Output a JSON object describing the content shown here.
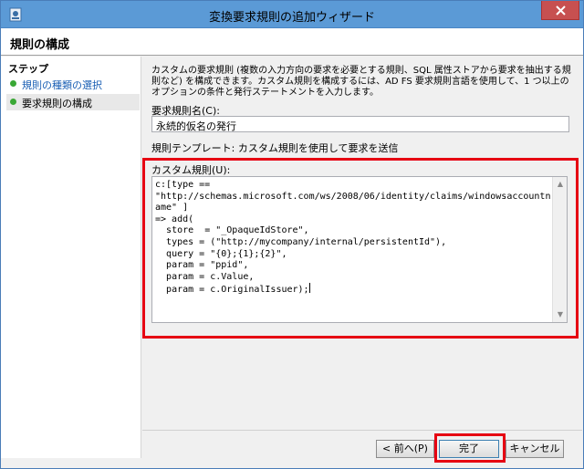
{
  "window": {
    "title": "変換要求規則の追加ウィザード",
    "close_glyph": "✕"
  },
  "header": {
    "title": "規則の構成"
  },
  "steps": {
    "title": "ステップ",
    "items": [
      {
        "label": "規則の種類の選択"
      },
      {
        "label": "要求規則の構成"
      }
    ]
  },
  "main": {
    "description": "カスタムの要求規則 (複数の入力方向の要求を必要とする規則、SQL 属性ストアから要求を抽出する規則など) を構成できます。カスタム規則を構成するには、AD FS 要求規則言語を使用して、1 つ以上のオプションの条件と発行ステートメントを入力します。",
    "rule_name_label": "要求規則名(C):",
    "rule_name_value": "永続的仮名の発行",
    "template_text": "規則テンプレート: カスタム規則を使用して要求を送信",
    "custom_rule_label": "カスタム規則(U):",
    "custom_rule_value": "c:[type ==\n\"http://schemas.microsoft.com/ws/2008/06/identity/claims/windowsaccountname\" ]\n=> add(\n  store  = \"_OpaqueIdStore\",\n  types = (\"http://mycompany/internal/persistentId\"),\n  query = \"{0};{1};{2}\",\n  param = \"ppid\",\n  param = c.Value,\n  param = c.OriginalIssuer);"
  },
  "footer": {
    "back_label": "< 前へ(P)",
    "finish_label": "完了",
    "cancel_label": "キャンセル"
  },
  "colors": {
    "highlight": "#e60012",
    "titlebar": "#5b9ad6",
    "step_done": "#3aa835"
  }
}
